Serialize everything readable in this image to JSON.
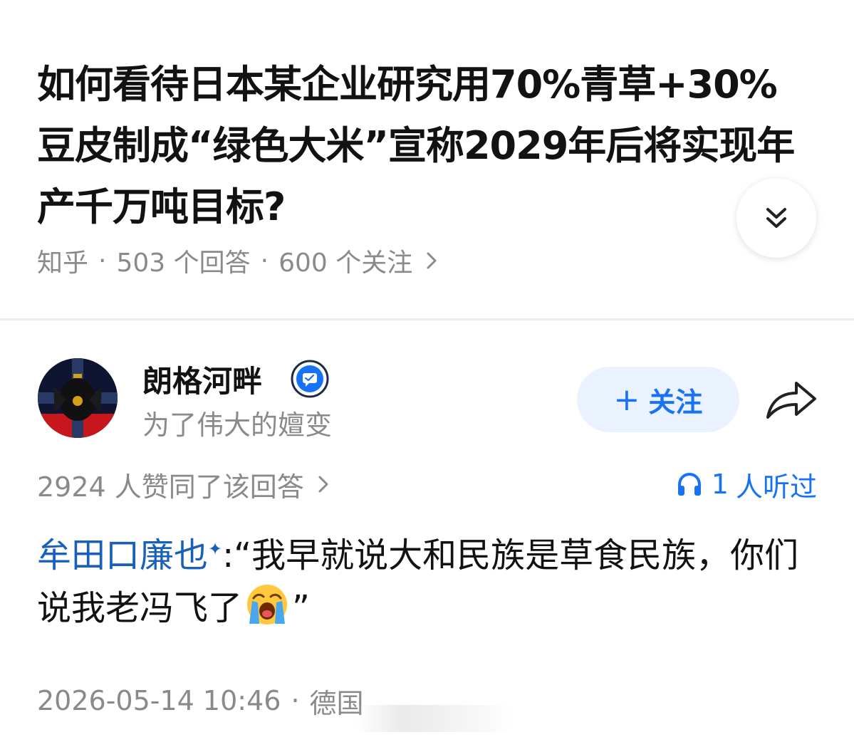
{
  "question": {
    "title": "如何看待日本某企业研究用70%青草+30%豆皮制成“绿色大米”宣称2029年后将实现年产千万吨目标?",
    "source": "知乎",
    "answers_count": "503 个回答",
    "followers_count": "600 个关注"
  },
  "author": {
    "name": "朗格河畔",
    "bio": "为了伟大的嬗变",
    "follow_label": "关注",
    "follow_plus": "+"
  },
  "answer": {
    "likes_text": "2924 人赞同了该回答",
    "listen_count": "1",
    "listen_text": "人听过",
    "mention_name": "牟田口廉也",
    "mention_mark": "✦",
    "colon": ":",
    "quote_text_part1": "“我早就说大和民族是草食民族，你们说我老冯飞了",
    "quote_text_part2": "”",
    "emoji_name": "loudly-crying-face"
  },
  "footer": {
    "timestamp": "2026-05-14 10:46",
    "location": "德国"
  },
  "icons": {
    "expand": "double-chevron-down-icon",
    "share": "share-arrow-icon",
    "headphones": "headphones-icon",
    "verify": "verified-badge-icon"
  },
  "colors": {
    "accent_blue": "#1772f6",
    "mention_blue": "#1961b8",
    "secondary_text": "#8a8a8a",
    "follow_bg": "#eaf2ff"
  }
}
